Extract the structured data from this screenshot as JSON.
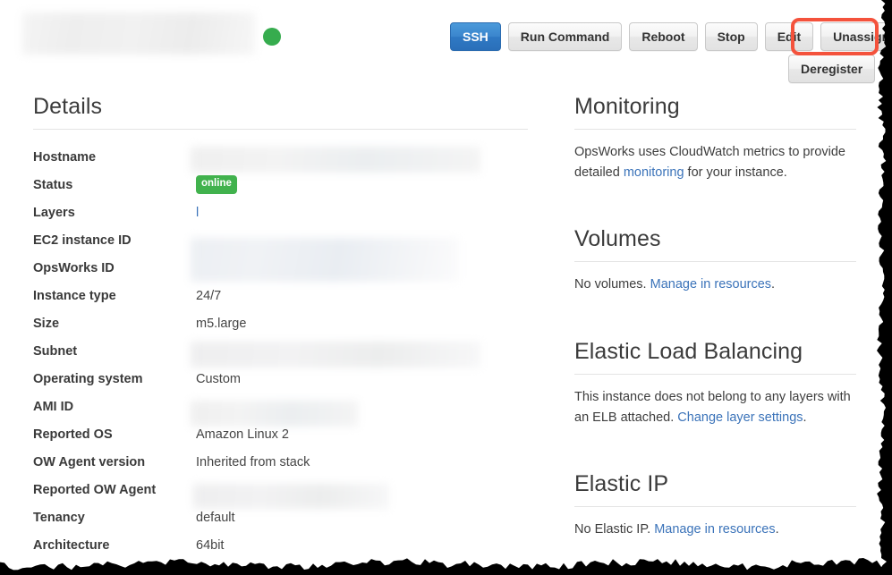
{
  "header": {
    "title_redacted": true,
    "status_indicator": "online-green-dot",
    "status_color": "#36ac4e",
    "buttons": [
      {
        "label": "SSH",
        "style": "primary"
      },
      {
        "label": "Run Command",
        "style": "default"
      },
      {
        "label": "Reboot",
        "style": "default"
      },
      {
        "label": "Stop",
        "style": "default"
      },
      {
        "label": "Edit",
        "style": "default"
      },
      {
        "label": "Unassign",
        "style": "default",
        "highlighted": true
      }
    ],
    "secondary_button": {
      "label": "Deregister"
    },
    "highlight_color": "#f4523c"
  },
  "details": {
    "title": "Details",
    "rows": [
      {
        "label": "Hostname",
        "value": "",
        "kind": "redacted"
      },
      {
        "label": "Status",
        "value": "online",
        "kind": "badge"
      },
      {
        "label": "Layers",
        "value": "l",
        "kind": "link"
      },
      {
        "label": "EC2 instance ID",
        "value": "",
        "kind": "redacted"
      },
      {
        "label": "OpsWorks ID",
        "value": "",
        "kind": "redacted"
      },
      {
        "label": "Instance type",
        "value": "24/7",
        "kind": "text"
      },
      {
        "label": "Size",
        "value": "m5.large",
        "kind": "text"
      },
      {
        "label": "Subnet",
        "value": "",
        "kind": "redacted"
      },
      {
        "label": "Operating system",
        "value": "Custom",
        "kind": "text"
      },
      {
        "label": "AMI ID",
        "value": "",
        "kind": "redacted"
      },
      {
        "label": "Reported OS",
        "value": "Amazon Linux 2",
        "kind": "text"
      },
      {
        "label": "OW Agent version",
        "value": "Inherited from stack",
        "kind": "text"
      },
      {
        "label": "Reported OW Agent",
        "value": "",
        "kind": "redacted"
      },
      {
        "label": "Tenancy",
        "value": "default",
        "kind": "text"
      },
      {
        "label": "Architecture",
        "value": "64bit",
        "kind": "text"
      }
    ],
    "badge_color": "#41b24d",
    "link_color": "#3b73b9"
  },
  "monitoring": {
    "title": "Monitoring",
    "text_before": "OpsWorks uses CloudWatch metrics to provide detailed ",
    "link": "monitoring",
    "text_after": " for your instance."
  },
  "volumes": {
    "title": "Volumes",
    "text_before": "No volumes. ",
    "link": "Manage in resources",
    "text_after": "."
  },
  "elb": {
    "title": "Elastic Load Balancing",
    "text_before": "This instance does not belong to any layers with an ELB attached. ",
    "link": "Change layer settings",
    "text_after": "."
  },
  "elastic_ip": {
    "title": "Elastic IP",
    "text_before": "No Elastic IP. ",
    "link": "Manage in resources",
    "text_after": "."
  }
}
